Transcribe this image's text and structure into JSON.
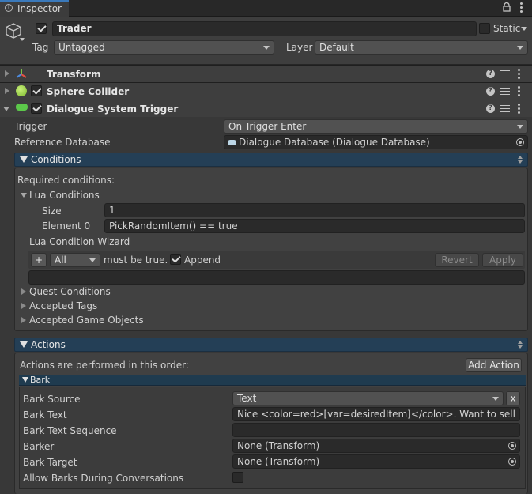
{
  "tab": {
    "title": "Inspector"
  },
  "object": {
    "name": "Trader",
    "active": true,
    "static_label": "Static",
    "tag_label": "Tag",
    "tag_value": "Untagged",
    "layer_label": "Layer",
    "layer_value": "Default"
  },
  "components": [
    {
      "title": "Transform"
    },
    {
      "title": "Sphere Collider",
      "enabled": true
    },
    {
      "title": "Dialogue System Trigger",
      "enabled": true
    }
  ],
  "trigger": {
    "trigger_label": "Trigger",
    "trigger_value": "On Trigger Enter",
    "db_label": "Reference Database",
    "db_value": "Dialogue Database (Dialogue Database)"
  },
  "conditions": {
    "header": "Conditions",
    "required_label": "Required conditions:",
    "lua_conditions_label": "Lua Conditions",
    "size_label": "Size",
    "size_value": "1",
    "element0_label": "Element 0",
    "element0_value": "PickRandomItem() == true",
    "wizard_label": "Lua Condition Wizard",
    "plus_label": "+",
    "all_value": "All",
    "must_be_true": "must be true.",
    "append_label": "Append",
    "append_checked": true,
    "revert_label": "Revert",
    "apply_label": "Apply",
    "quest_conditions": "Quest Conditions",
    "accepted_tags": "Accepted Tags",
    "accepted_game_objects": "Accepted Game Objects"
  },
  "actions": {
    "header": "Actions",
    "order_label": "Actions are performed in this order:",
    "add_action_label": "Add Action",
    "bark_header": "Bark",
    "bark_source_label": "Bark Source",
    "bark_source_value": "Text",
    "remove_label": "x",
    "bark_text_label": "Bark Text",
    "bark_text_value": "Nice <color=red>[var=desiredItem]</color>. Want to sell it?",
    "bark_text_sequence_label": "Bark Text Sequence",
    "bark_text_sequence_value": "",
    "barker_label": "Barker",
    "barker_value": "None (Transform)",
    "bark_target_label": "Bark Target",
    "bark_target_value": "None (Transform)",
    "allow_barks_label": "Allow Barks During Conversations",
    "allow_barks_checked": false
  },
  "colors": {
    "background": "#383838",
    "section_bar": "#243f56",
    "field": "#2a2a2a"
  }
}
